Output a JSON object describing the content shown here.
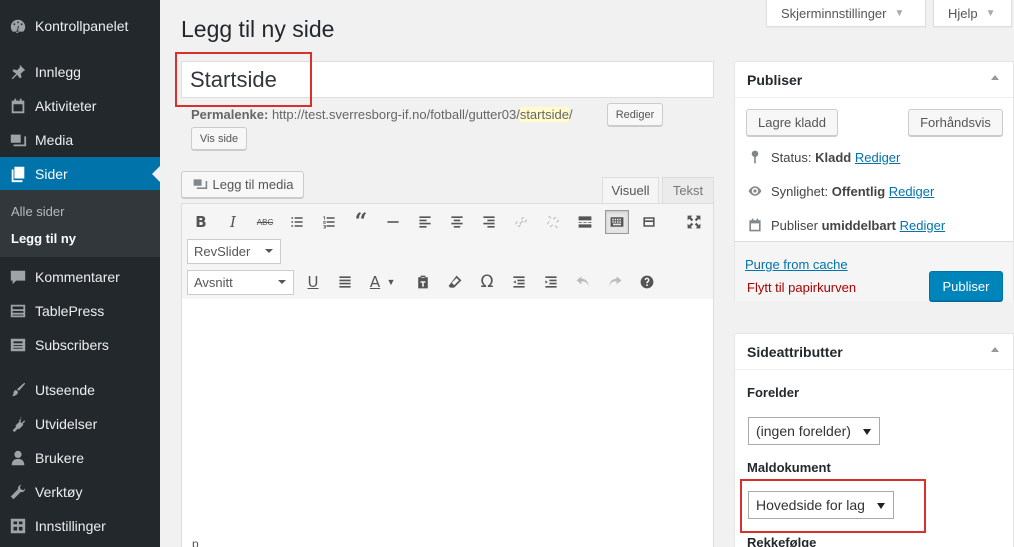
{
  "sidebar": {
    "items": [
      {
        "label": "Kontrollpanelet",
        "icon": "dashboard-icon"
      },
      {
        "label": "Innlegg",
        "icon": "pin-icon"
      },
      {
        "label": "Aktiviteter",
        "icon": "calendar-icon"
      },
      {
        "label": "Media",
        "icon": "media-icon"
      },
      {
        "label": "Sider",
        "icon": "pages-icon"
      },
      {
        "label": "Kommentarer",
        "icon": "comment-icon"
      },
      {
        "label": "TablePress",
        "icon": "table-icon"
      },
      {
        "label": "Subscribers",
        "icon": "list-icon"
      },
      {
        "label": "Utseende",
        "icon": "brush-icon"
      },
      {
        "label": "Utvidelser",
        "icon": "plugin-icon"
      },
      {
        "label": "Brukere",
        "icon": "user-icon"
      },
      {
        "label": "Verktøy",
        "icon": "wrench-icon"
      },
      {
        "label": "Innstillinger",
        "icon": "settings-icon"
      }
    ],
    "submenu": [
      "Alle sider",
      "Legg til ny"
    ],
    "accent": "#0073aa"
  },
  "top": {
    "screen_options": "Skjerminnstillinger",
    "help": "Hjelp"
  },
  "page_title": "Legg til ny side",
  "title_value": "Startside",
  "permalink": {
    "label": "Permalenke:",
    "base": "http://test.sverresborg-if.no/fotball/gutter03/",
    "slug": "startside",
    "trail": "/",
    "edit": "Rediger",
    "view": "Vis side"
  },
  "editor": {
    "add_media": "Legg til media",
    "tab_visual": "Visuell",
    "tab_text": "Tekst",
    "revslider": "RevSlider",
    "format": "Avsnitt",
    "text_color_letter": "A",
    "body_peek": "p"
  },
  "publish": {
    "title": "Publiser",
    "save_draft": "Lagre kladd",
    "preview": "Forhåndsvis",
    "status_label": "Status:",
    "status_value": "Kladd",
    "visibility_label": "Synlighet:",
    "visibility_value": "Offentlig",
    "schedule_label": "Publiser",
    "schedule_value": "umiddelbart",
    "edit": "Rediger",
    "purge": "Purge from cache",
    "trash": "Flytt til papirkurven",
    "publish_button": "Publiser"
  },
  "attributes": {
    "title": "Sideattributter",
    "parent_label": "Forelder",
    "parent_value": "(ingen forelder)",
    "template_label": "Maldokument",
    "template_value": "Hovedside for lag",
    "order_label": "Rekkefølge"
  }
}
